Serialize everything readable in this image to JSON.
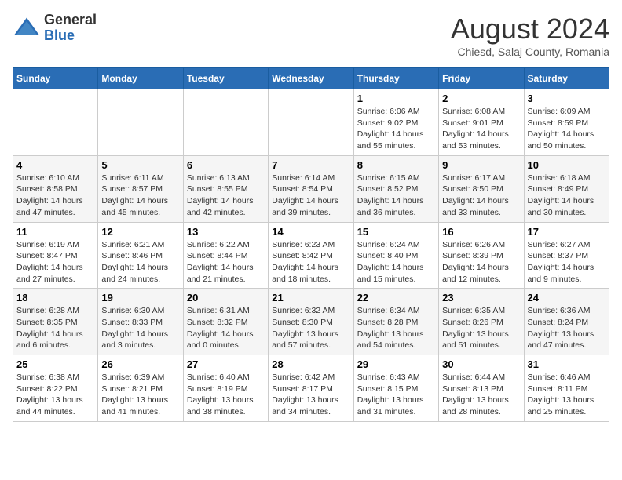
{
  "logo": {
    "general": "General",
    "blue": "Blue"
  },
  "header": {
    "month": "August 2024",
    "location": "Chiesd, Salaj County, Romania"
  },
  "weekdays": [
    "Sunday",
    "Monday",
    "Tuesday",
    "Wednesday",
    "Thursday",
    "Friday",
    "Saturday"
  ],
  "weeks": [
    [
      {
        "day": "",
        "info": ""
      },
      {
        "day": "",
        "info": ""
      },
      {
        "day": "",
        "info": ""
      },
      {
        "day": "",
        "info": ""
      },
      {
        "day": "1",
        "info": "Sunrise: 6:06 AM\nSunset: 9:02 PM\nDaylight: 14 hours and 55 minutes."
      },
      {
        "day": "2",
        "info": "Sunrise: 6:08 AM\nSunset: 9:01 PM\nDaylight: 14 hours and 53 minutes."
      },
      {
        "day": "3",
        "info": "Sunrise: 6:09 AM\nSunset: 8:59 PM\nDaylight: 14 hours and 50 minutes."
      }
    ],
    [
      {
        "day": "4",
        "info": "Sunrise: 6:10 AM\nSunset: 8:58 PM\nDaylight: 14 hours and 47 minutes."
      },
      {
        "day": "5",
        "info": "Sunrise: 6:11 AM\nSunset: 8:57 PM\nDaylight: 14 hours and 45 minutes."
      },
      {
        "day": "6",
        "info": "Sunrise: 6:13 AM\nSunset: 8:55 PM\nDaylight: 14 hours and 42 minutes."
      },
      {
        "day": "7",
        "info": "Sunrise: 6:14 AM\nSunset: 8:54 PM\nDaylight: 14 hours and 39 minutes."
      },
      {
        "day": "8",
        "info": "Sunrise: 6:15 AM\nSunset: 8:52 PM\nDaylight: 14 hours and 36 minutes."
      },
      {
        "day": "9",
        "info": "Sunrise: 6:17 AM\nSunset: 8:50 PM\nDaylight: 14 hours and 33 minutes."
      },
      {
        "day": "10",
        "info": "Sunrise: 6:18 AM\nSunset: 8:49 PM\nDaylight: 14 hours and 30 minutes."
      }
    ],
    [
      {
        "day": "11",
        "info": "Sunrise: 6:19 AM\nSunset: 8:47 PM\nDaylight: 14 hours and 27 minutes."
      },
      {
        "day": "12",
        "info": "Sunrise: 6:21 AM\nSunset: 8:46 PM\nDaylight: 14 hours and 24 minutes."
      },
      {
        "day": "13",
        "info": "Sunrise: 6:22 AM\nSunset: 8:44 PM\nDaylight: 14 hours and 21 minutes."
      },
      {
        "day": "14",
        "info": "Sunrise: 6:23 AM\nSunset: 8:42 PM\nDaylight: 14 hours and 18 minutes."
      },
      {
        "day": "15",
        "info": "Sunrise: 6:24 AM\nSunset: 8:40 PM\nDaylight: 14 hours and 15 minutes."
      },
      {
        "day": "16",
        "info": "Sunrise: 6:26 AM\nSunset: 8:39 PM\nDaylight: 14 hours and 12 minutes."
      },
      {
        "day": "17",
        "info": "Sunrise: 6:27 AM\nSunset: 8:37 PM\nDaylight: 14 hours and 9 minutes."
      }
    ],
    [
      {
        "day": "18",
        "info": "Sunrise: 6:28 AM\nSunset: 8:35 PM\nDaylight: 14 hours and 6 minutes."
      },
      {
        "day": "19",
        "info": "Sunrise: 6:30 AM\nSunset: 8:33 PM\nDaylight: 14 hours and 3 minutes."
      },
      {
        "day": "20",
        "info": "Sunrise: 6:31 AM\nSunset: 8:32 PM\nDaylight: 14 hours and 0 minutes."
      },
      {
        "day": "21",
        "info": "Sunrise: 6:32 AM\nSunset: 8:30 PM\nDaylight: 13 hours and 57 minutes."
      },
      {
        "day": "22",
        "info": "Sunrise: 6:34 AM\nSunset: 8:28 PM\nDaylight: 13 hours and 54 minutes."
      },
      {
        "day": "23",
        "info": "Sunrise: 6:35 AM\nSunset: 8:26 PM\nDaylight: 13 hours and 51 minutes."
      },
      {
        "day": "24",
        "info": "Sunrise: 6:36 AM\nSunset: 8:24 PM\nDaylight: 13 hours and 47 minutes."
      }
    ],
    [
      {
        "day": "25",
        "info": "Sunrise: 6:38 AM\nSunset: 8:22 PM\nDaylight: 13 hours and 44 minutes."
      },
      {
        "day": "26",
        "info": "Sunrise: 6:39 AM\nSunset: 8:21 PM\nDaylight: 13 hours and 41 minutes."
      },
      {
        "day": "27",
        "info": "Sunrise: 6:40 AM\nSunset: 8:19 PM\nDaylight: 13 hours and 38 minutes."
      },
      {
        "day": "28",
        "info": "Sunrise: 6:42 AM\nSunset: 8:17 PM\nDaylight: 13 hours and 34 minutes."
      },
      {
        "day": "29",
        "info": "Sunrise: 6:43 AM\nSunset: 8:15 PM\nDaylight: 13 hours and 31 minutes."
      },
      {
        "day": "30",
        "info": "Sunrise: 6:44 AM\nSunset: 8:13 PM\nDaylight: 13 hours and 28 minutes."
      },
      {
        "day": "31",
        "info": "Sunrise: 6:46 AM\nSunset: 8:11 PM\nDaylight: 13 hours and 25 minutes."
      }
    ]
  ]
}
